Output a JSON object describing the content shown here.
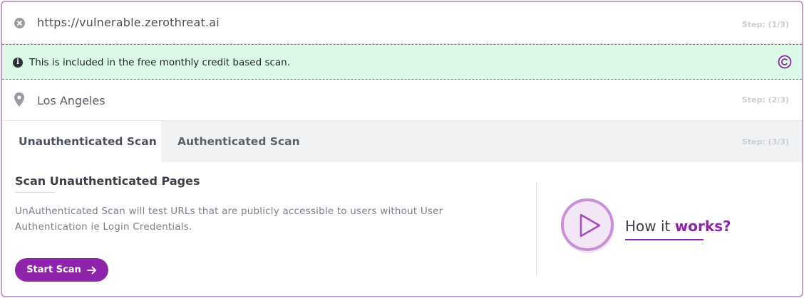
{
  "url_row": {
    "url": "https://vulnerable.zerothreat.ai",
    "step": "Step: (1/3)"
  },
  "info_banner": {
    "text": "This is included in the free monthly credit based scan.",
    "icon": "info-icon",
    "credit_icon": "copyright-c-icon"
  },
  "location_row": {
    "location": "Los Angeles",
    "step": "Step: (2/3)"
  },
  "tabs": {
    "items": [
      {
        "label": "Unauthenticated Scan",
        "active": true
      },
      {
        "label": "Authenticated Scan",
        "active": false
      }
    ],
    "step": "Step: (3/3)"
  },
  "content": {
    "title": "Scan Unauthenticated Pages",
    "description": "UnAuthenticated Scan will test URLs that are publicly accessible to users without User Authentication ie Login Credentials.",
    "start_button": "Start Scan"
  },
  "how_it_works": {
    "prefix": "How it ",
    "accent": "works?"
  },
  "colors": {
    "accent": "#8e24aa",
    "banner_bg": "#dcf8e7",
    "border": "#c99ad6"
  }
}
